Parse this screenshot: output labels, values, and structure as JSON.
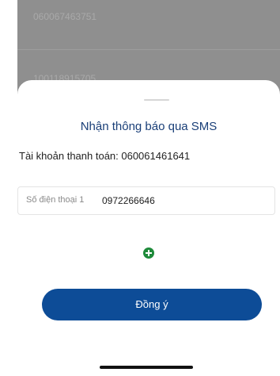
{
  "background": {
    "rows": [
      "060067463751",
      "100118915705"
    ]
  },
  "sheet": {
    "title": "Nhận thông báo qua SMS",
    "account_line": "Tài khoản thanh toán: 060061461641",
    "phone_field": {
      "label": "Số điện thoại 1",
      "value": "0972266646"
    },
    "add_icon": "plus-circle-icon",
    "agree_label": "Đồng ý"
  },
  "colors": {
    "title": "#1a3f78",
    "primary_button": "#0d4c97",
    "add_icon": "#1e8a3a"
  }
}
